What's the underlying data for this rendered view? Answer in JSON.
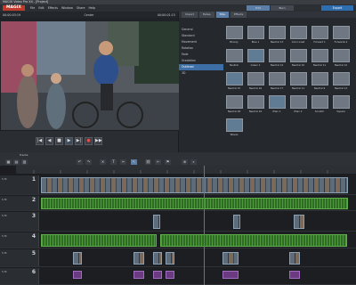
{
  "window": {
    "title": "MAGIX Video Pro X4 - [Project]"
  },
  "menu": {
    "logo": "MAGIX",
    "items": [
      "File",
      "Edit",
      "Effects",
      "Window",
      "Share",
      "Help"
    ]
  },
  "modes": [
    "Edit",
    "Burn"
  ],
  "export_label": "Export",
  "monitor": {
    "left_label": "00:00:03:19",
    "center_label": "Center",
    "right_label": "00:00:01:15"
  },
  "media": {
    "tabs": [
      "Import",
      "Fades",
      "Title",
      "Effects"
    ],
    "categories": [
      "General",
      "Standard",
      "Movement",
      "Rotation",
      "Fade",
      "Gradation",
      "Outlined",
      "3D"
    ],
    "selected_category": "Outlined",
    "thumbs": [
      [
        "Bloody",
        "Blue 1",
        "Neutral 13",
        "Color inset",
        "Forward 1",
        "Forwards 2"
      ],
      [
        "Neutral",
        "Green 1",
        "Neutral 14",
        "Neutral 10",
        "Neutral 11",
        "Neutral 12"
      ],
      [
        "Neutral 15",
        "Neutral 16",
        "Neutral 17",
        "Neutral 11",
        "Neutral 9",
        "Neutral 13"
      ],
      [
        "Neutral 18",
        "Neutral 19",
        "Plain 1",
        "Plain 2",
        "Scratch",
        "Square"
      ],
      [
        "Waves"
      ]
    ]
  },
  "timeline": {
    "label": "Tracks",
    "tracks": [
      {
        "num": "1",
        "ctrl": "S M"
      },
      {
        "num": "2",
        "ctrl": "S M"
      },
      {
        "num": "3",
        "ctrl": "S M"
      },
      {
        "num": "4",
        "ctrl": "S M"
      },
      {
        "num": "5",
        "ctrl": "S M"
      },
      {
        "num": "6",
        "ctrl": "S M"
      }
    ]
  },
  "transport": {
    "buttons": [
      "|◀",
      "◀",
      "■",
      "▶",
      "▶|",
      "●",
      "▶▶"
    ]
  }
}
